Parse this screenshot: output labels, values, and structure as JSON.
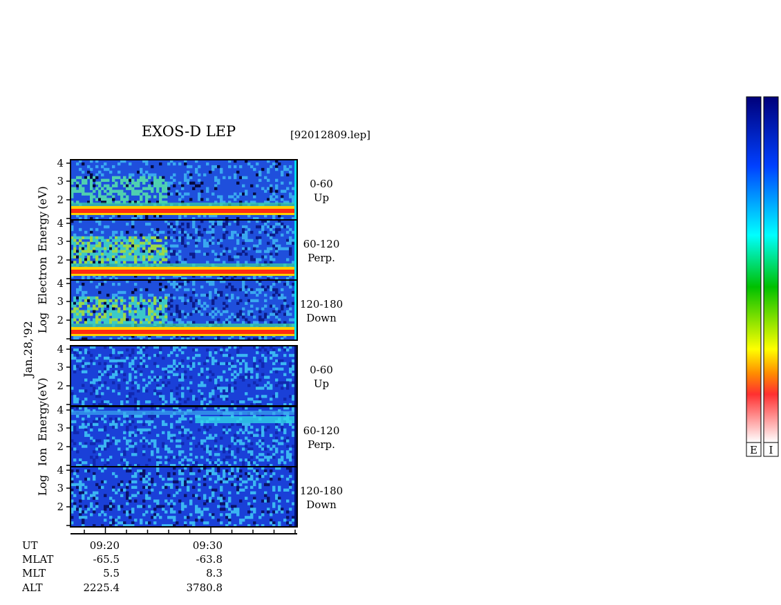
{
  "title": "EXOS-D LEP",
  "file_label": "[92012809.lep]",
  "date_label": "Jan.28,'92",
  "electron_ylabel": [
    "Log",
    "Electron",
    "Energy",
    "(eV)"
  ],
  "ion_ylabel": [
    "Log",
    "Ion",
    "Energy",
    "(eV)"
  ],
  "colorbar_labels": [
    "E",
    "I"
  ],
  "colors": {
    "background_low": "#0a2090",
    "colorscale": [
      "#ffffff",
      "#ff0000",
      "#ffff00",
      "#00c000",
      "#00ffff",
      "#0030ff",
      "#00007a"
    ]
  },
  "orbit_table": {
    "row_labels": [
      "UT",
      "MLAT",
      "MLT",
      "ALT"
    ],
    "columns": [
      {
        "UT": "09:20",
        "MLAT": "-65.5",
        "MLT": "5.5",
        "ALT": "2225.4"
      },
      {
        "UT": "09:30",
        "MLAT": "-63.8",
        "MLT": "8.3",
        "ALT": "3780.8"
      }
    ]
  },
  "chart_data": {
    "type": "heatmap",
    "x_unit": "UT",
    "yticks": [
      "2",
      "3",
      "4"
    ],
    "panels": [
      {
        "species": "Electron",
        "pitch_angle": "0-60",
        "direction": "Up"
      },
      {
        "species": "Electron",
        "pitch_angle": "60-120",
        "direction": "Perp."
      },
      {
        "species": "Electron",
        "pitch_angle": "120-180",
        "direction": "Down"
      },
      {
        "species": "Ion",
        "pitch_angle": "0-60",
        "direction": "Up"
      },
      {
        "species": "Ion",
        "pitch_angle": "60-120",
        "direction": "Perp."
      },
      {
        "species": "Ion",
        "pitch_angle": "120-180",
        "direction": "Down"
      }
    ]
  }
}
